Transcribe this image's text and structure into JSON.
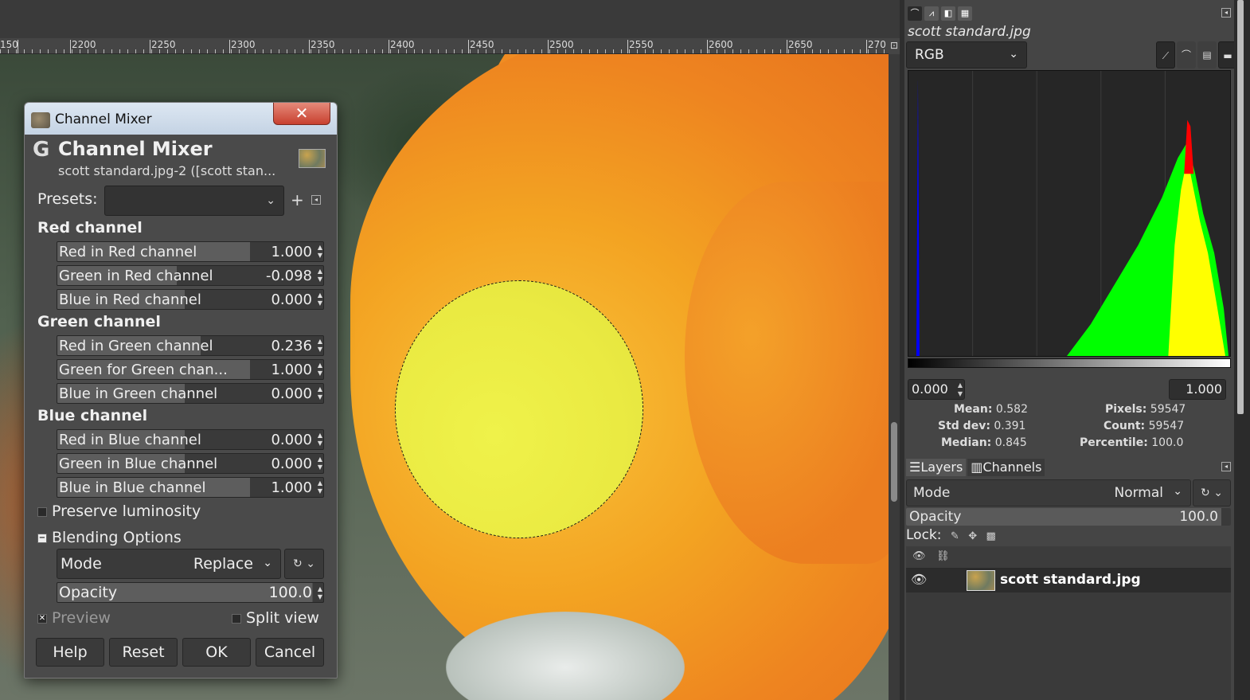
{
  "canvas": {
    "ruler_labels": [
      "150",
      "2200",
      "2250",
      "2300",
      "2350",
      "2400",
      "2450",
      "2500",
      "2550",
      "2600",
      "2650",
      "270"
    ]
  },
  "histogram": {
    "image_title": "scott standard.jpg",
    "channel": "RGB",
    "range_min": "0.000",
    "range_max": "1.000",
    "stats": {
      "mean_label": "Mean:",
      "mean": "0.582",
      "stddev_label": "Std dev:",
      "stddev": "0.391",
      "median_label": "Median:",
      "median": "0.845",
      "pixels_label": "Pixels:",
      "pixels": "59547",
      "count_label": "Count:",
      "count": "59547",
      "percentile_label": "Percentile:",
      "percentile": "100.0"
    },
    "colors": {
      "blue": "#0000ff",
      "green": "#00ff00",
      "yellow": "#ffff00",
      "red": "#ff0000"
    }
  },
  "layers": {
    "tabs": [
      "Layers",
      "Channels"
    ],
    "mode_label": "Mode",
    "mode_value": "Normal",
    "opacity_label": "Opacity",
    "opacity_value": "100.0",
    "lock_label": "Lock:",
    "items": [
      {
        "name": "scott standard.jpg",
        "visible": true
      }
    ]
  },
  "dialog": {
    "window_title": "Channel Mixer",
    "close_glyph": "✕",
    "heading": "Channel Mixer",
    "subtitle": "scott standard.jpg-2 ([scott stan...",
    "presets_label": "Presets:",
    "presets_value": "",
    "red_section": "Red channel",
    "green_section": "Green channel",
    "blue_section": "Blue channel",
    "red": {
      "r": {
        "label": "Red in Red channel",
        "value": "1.000"
      },
      "g": {
        "label": "Green in Red channel",
        "value": "-0.098"
      },
      "b": {
        "label": "Blue in Red channel",
        "value": "0.000"
      }
    },
    "green": {
      "r": {
        "label": "Red in Green channel",
        "value": "0.236"
      },
      "g": {
        "label": "Green for Green chan...",
        "value": "1.000"
      },
      "b": {
        "label": "Blue in Green channel",
        "value": "0.000"
      }
    },
    "blue": {
      "r": {
        "label": "Red in Blue channel",
        "value": "0.000"
      },
      "g": {
        "label": "Green in Blue channel",
        "value": "0.000"
      },
      "b": {
        "label": "Blue in Blue channel",
        "value": "1.000"
      }
    },
    "preserve_luminosity": "Preserve luminosity",
    "blending_options": "Blending Options",
    "blend_mode_label": "Mode",
    "blend_mode_value": "Replace",
    "blend_opacity_label": "Opacity",
    "blend_opacity_value": "100.0",
    "preview_label": "Preview",
    "split_view_label": "Split view",
    "buttons": {
      "help": "Help",
      "reset": "Reset",
      "ok": "OK",
      "cancel": "Cancel"
    }
  }
}
